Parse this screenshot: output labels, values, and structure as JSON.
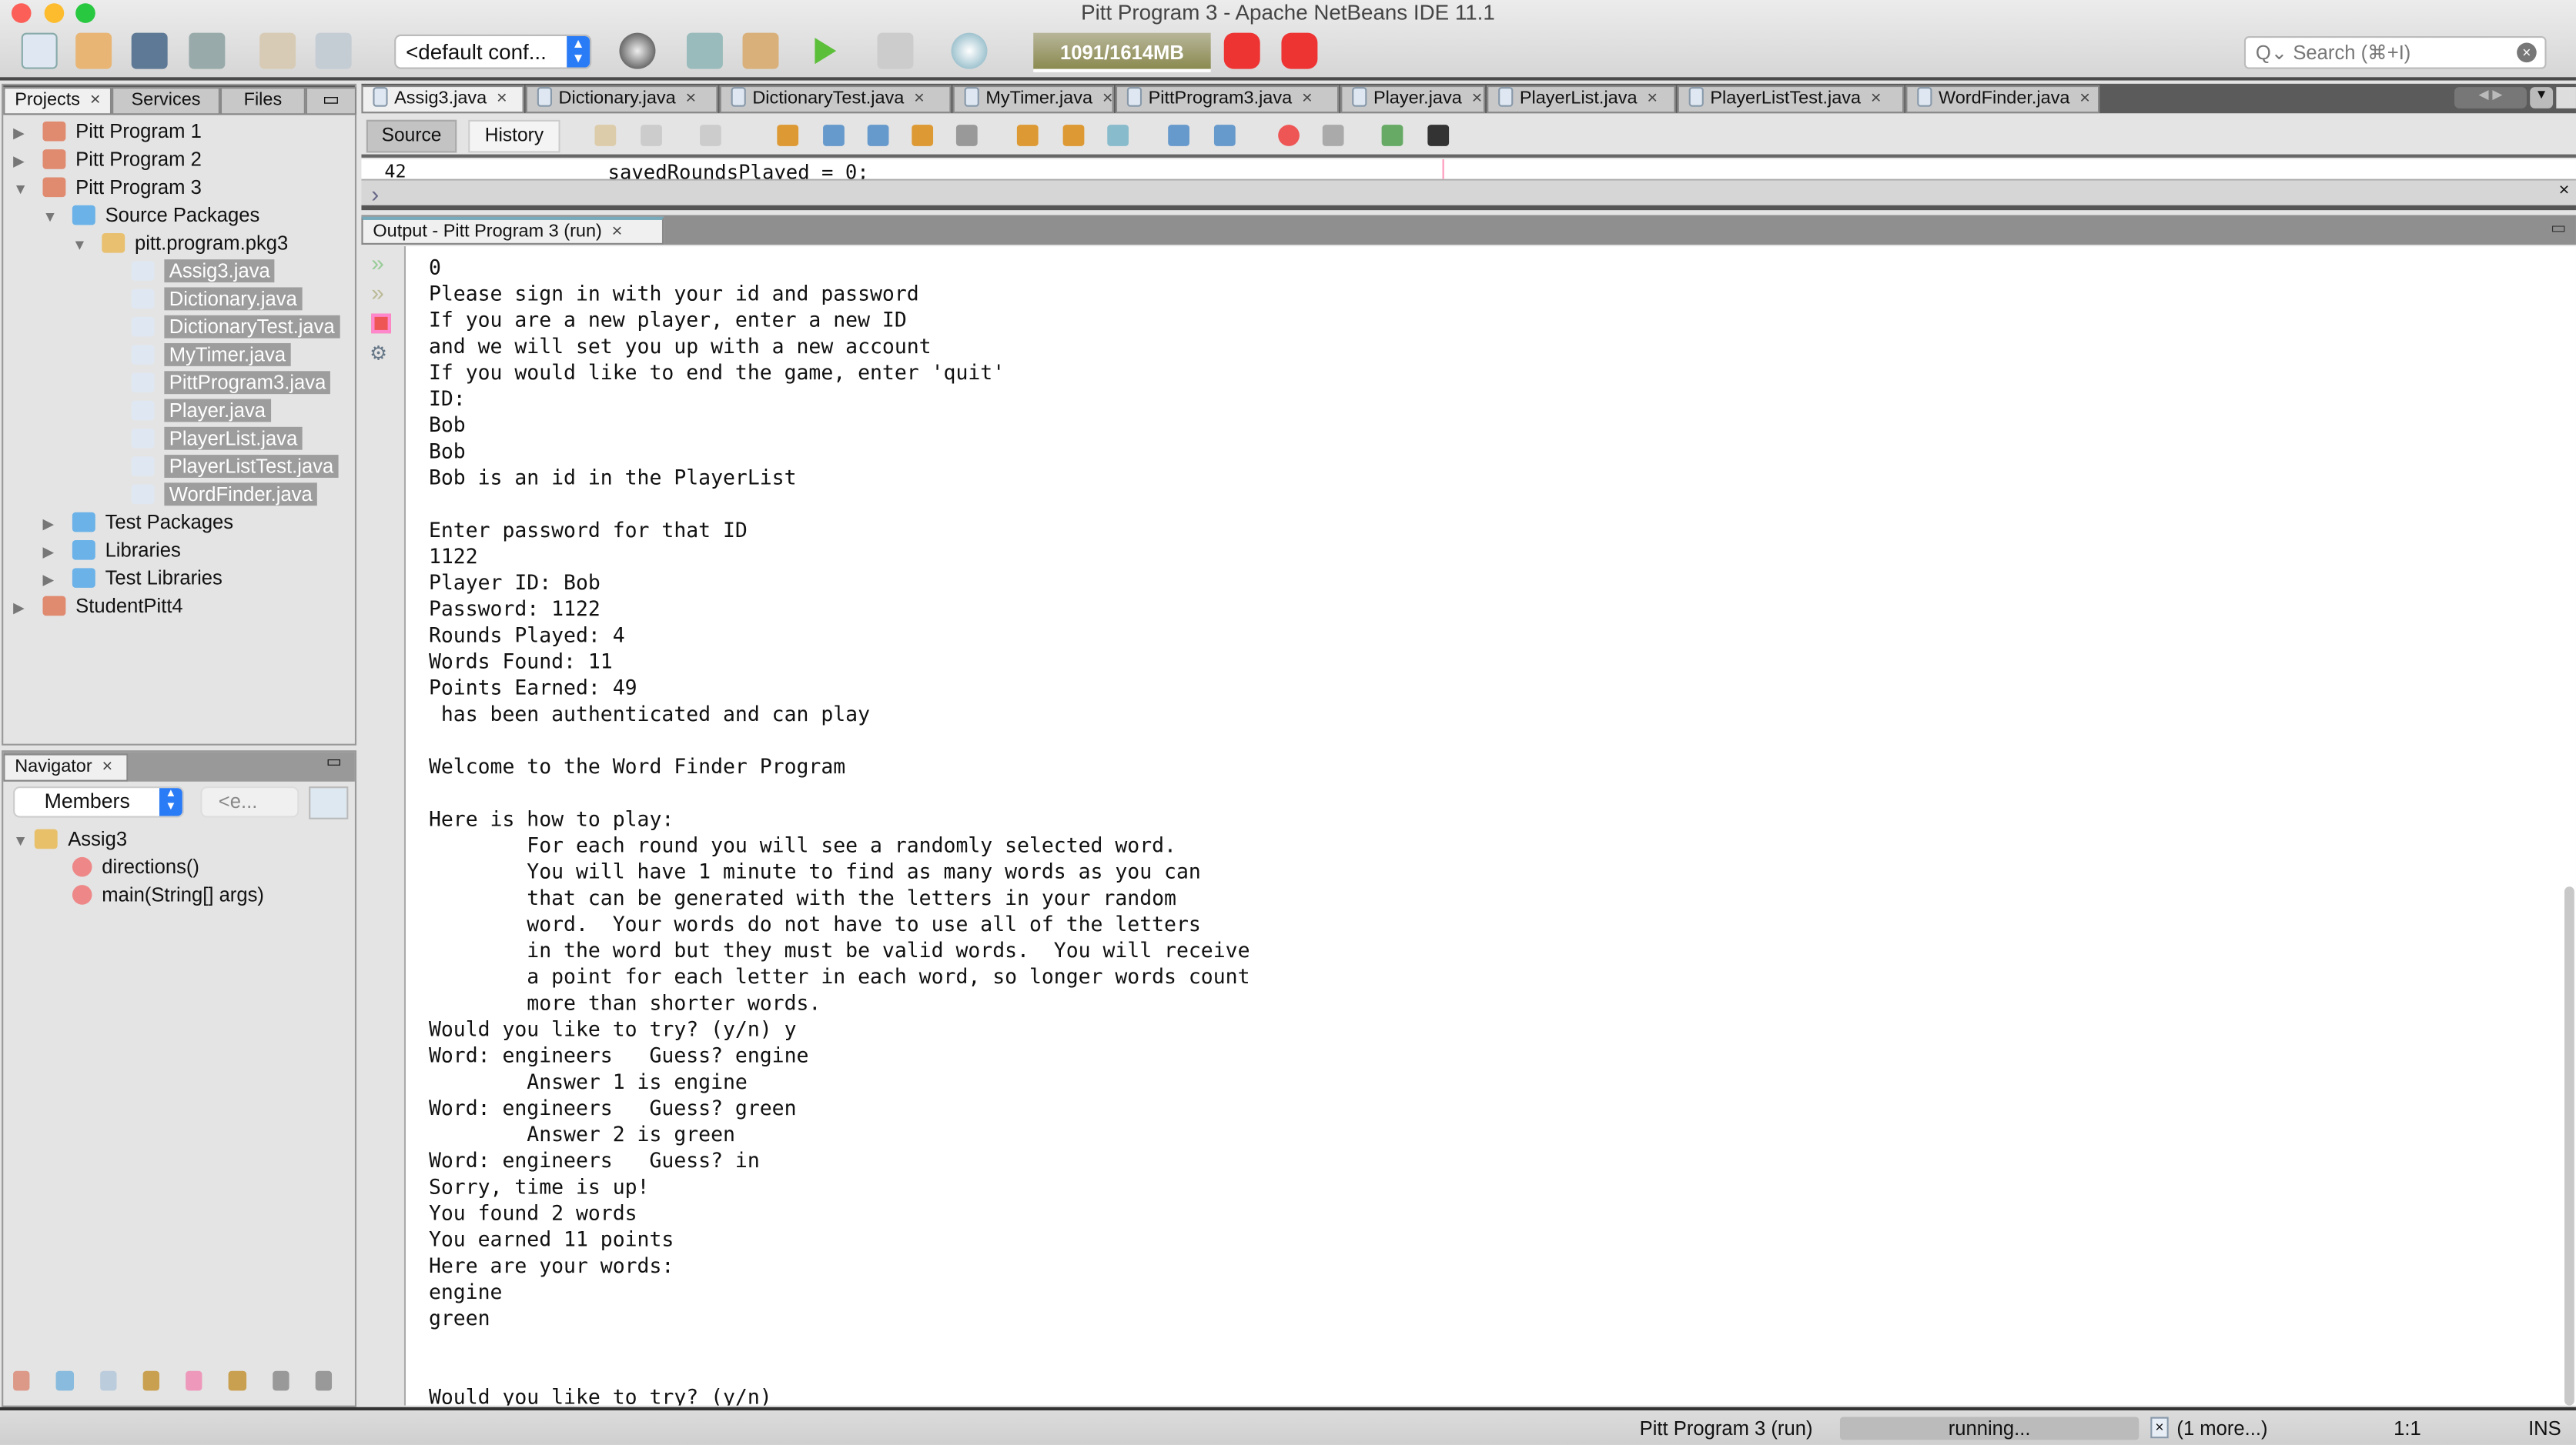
{
  "window": {
    "title": "Pitt Program 3 - Apache NetBeans IDE 11.1"
  },
  "toolbar": {
    "config": "<default conf...",
    "memory": "1091/1614MB",
    "search_placeholder": "Search (⌘+I)"
  },
  "left_tabs": [
    "Projects",
    "Services",
    "Files"
  ],
  "projects": [
    {
      "label": "Pitt Program 1",
      "level": 0,
      "expanded": false,
      "icon": "project-icon"
    },
    {
      "label": "Pitt Program 2",
      "level": 0,
      "expanded": false,
      "icon": "project-icon"
    },
    {
      "label": "Pitt Program 3",
      "level": 0,
      "expanded": true,
      "icon": "project-icon"
    },
    {
      "label": "Source Packages",
      "level": 1,
      "expanded": true,
      "icon": "folder-icon"
    },
    {
      "label": "pitt.program.pkg3",
      "level": 2,
      "expanded": true,
      "icon": "package-icon"
    },
    {
      "label": "Assig3.java",
      "level": 3,
      "selected": true,
      "icon": "java-file-icon"
    },
    {
      "label": "Dictionary.java",
      "level": 3,
      "selected": true,
      "icon": "java-file-icon"
    },
    {
      "label": "DictionaryTest.java",
      "level": 3,
      "selected": true,
      "icon": "java-file-icon"
    },
    {
      "label": "MyTimer.java",
      "level": 3,
      "selected": true,
      "icon": "java-file-icon"
    },
    {
      "label": "PittProgram3.java",
      "level": 3,
      "selected": true,
      "icon": "java-file-icon"
    },
    {
      "label": "Player.java",
      "level": 3,
      "selected": true,
      "icon": "java-file-icon"
    },
    {
      "label": "PlayerList.java",
      "level": 3,
      "selected": true,
      "icon": "java-file-icon"
    },
    {
      "label": "PlayerListTest.java",
      "level": 3,
      "selected": true,
      "icon": "java-file-icon"
    },
    {
      "label": "WordFinder.java",
      "level": 3,
      "selected": true,
      "icon": "java-file-icon"
    },
    {
      "label": "Test Packages",
      "level": 1,
      "expanded": false,
      "icon": "folder-icon"
    },
    {
      "label": "Libraries",
      "level": 1,
      "expanded": false,
      "icon": "library-icon"
    },
    {
      "label": "Test Libraries",
      "level": 1,
      "expanded": false,
      "icon": "library-icon"
    },
    {
      "label": "StudentPitt4",
      "level": 0,
      "expanded": false,
      "icon": "project-icon"
    }
  ],
  "navigator": {
    "title": "Navigator",
    "filter": "Members",
    "secondary": "<e...",
    "root": "Assig3",
    "members": [
      "directions()",
      "main(String[] args)"
    ]
  },
  "editor_tabs": [
    "Assig3.java",
    "Dictionary.java",
    "DictionaryTest.java",
    "MyTimer.java",
    "PittProgram3.java",
    "Player.java",
    "PlayerList.java",
    "PlayerListTest.java",
    "WordFinder.java"
  ],
  "editor": {
    "source_label": "Source",
    "history_label": "History",
    "line_number": "42",
    "code": "savedRoundsPlayed = 0;"
  },
  "output": {
    "tab": "Output - Pitt Program 3 (run)",
    "text": "0\nPlease sign in with your id and password\nIf you are a new player, enter a new ID\nand we will set you up with a new account\nIf you would like to end the game, enter 'quit'\nID:\nBob\nBob\nBob is an id in the PlayerList\n\nEnter password for that ID\n1122\nPlayer ID: Bob\nPassword: 1122\nRounds Played: 4\nWords Found: 11\nPoints Earned: 49\n has been authenticated and can play\n\nWelcome to the Word Finder Program\n\nHere is how to play:\n        For each round you will see a randomly selected word.\n        You will have 1 minute to find as many words as you can\n        that can be generated with the letters in your random\n        word.  Your words do not have to use all of the letters\n        in the word but they must be valid words.  You will receive\n        a point for each letter in each word, so longer words count\n        more than shorter words.\nWould you like to try? (y/n) y\nWord: engineers   Guess? engine\n        Answer 1 is engine\nWord: engineers   Guess? green\n        Answer 2 is green\nWord: engineers   Guess? in\nSorry, time is up!\nYou found 2 words\nYou earned 11 points\nHere are your words:\nengine\ngreen\n\n\nWould you like to try? (y/n)"
  },
  "status": {
    "task": "Pitt Program 3 (run)",
    "progress": "running...",
    "more": "(1 more...)",
    "position": "1:1",
    "mode": "INS"
  }
}
